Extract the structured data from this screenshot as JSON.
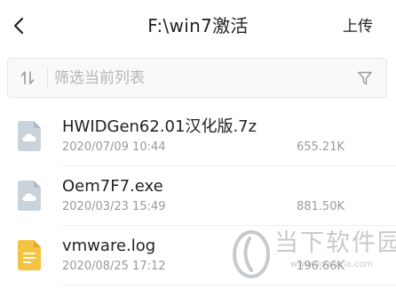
{
  "header": {
    "title": "F:\\win7激活",
    "upload_label": "上传",
    "back_icon": "chevron-left-icon"
  },
  "search": {
    "placeholder": "筛选当前列表",
    "value": "",
    "sort_icon": "sort-arrows-icon",
    "filter_icon": "filter-funnel-icon"
  },
  "files": [
    {
      "name": "HWIDGen62.01汉化版.7z",
      "date": "2020/07/09 10:44",
      "size": "655.21K",
      "icon": "cloud-file-icon",
      "icon_color": "#c9d3dc"
    },
    {
      "name": "Oem7F7.exe",
      "date": "2020/03/23 15:49",
      "size": "881.50K",
      "icon": "cloud-file-icon",
      "icon_color": "#c9d3dc"
    },
    {
      "name": "vmware.log",
      "date": "2020/08/25 17:12",
      "size": "196.66K",
      "icon": "document-file-icon",
      "icon_color": "#f5c342"
    }
  ],
  "watermark": {
    "text": "当下软件园",
    "url": "www.downxia.com"
  }
}
